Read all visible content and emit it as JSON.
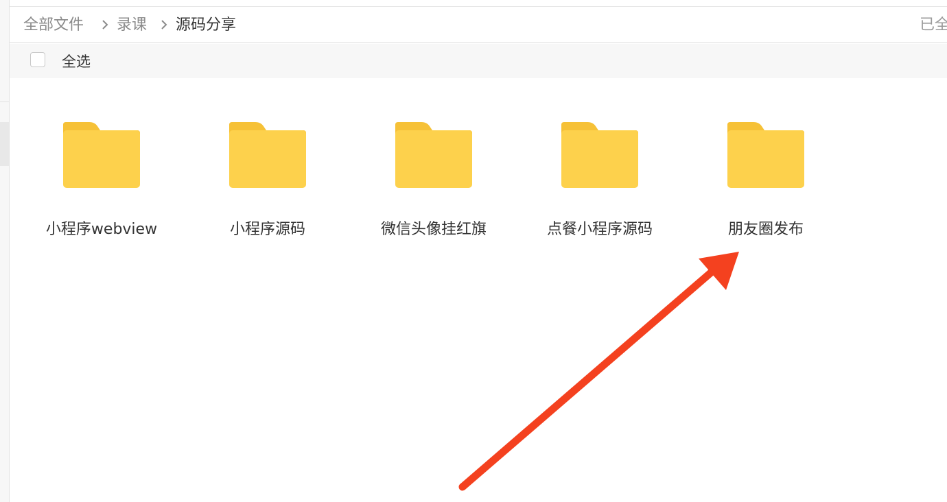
{
  "breadcrumb": {
    "items": [
      "全部文件",
      "录课",
      "源码分享"
    ]
  },
  "status": {
    "text": "已全"
  },
  "select_bar": {
    "select_all_label": "全选"
  },
  "folders": [
    {
      "name": "小程序webview"
    },
    {
      "name": "小程序源码"
    },
    {
      "name": "微信头像挂红旗"
    },
    {
      "name": "点餐小程序源码"
    },
    {
      "name": "朋友圈发布"
    }
  ],
  "colors": {
    "folder_body": "#fdd14c",
    "folder_tab": "#f6c137",
    "annotation_arrow": "#f4411f"
  }
}
